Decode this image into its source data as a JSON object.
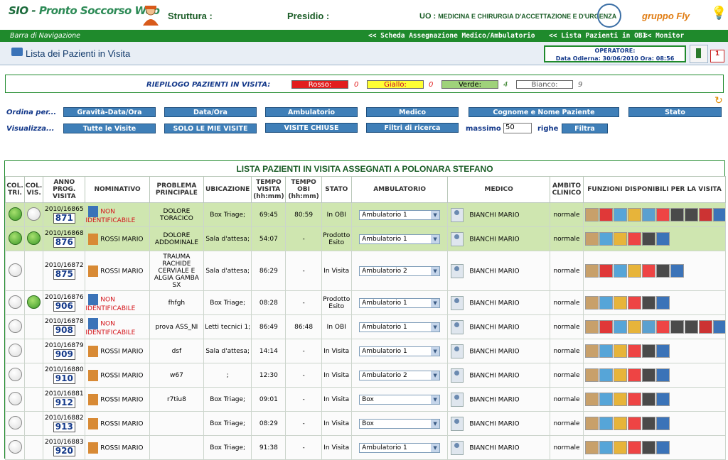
{
  "header": {
    "logo_text": "SIO - Pronto Soccorso Web",
    "struttura_label": "Struttura :",
    "presidio_label": "Presidio :",
    "uo_label": "UO :",
    "uo_value": "MEDICINA E CHIRURGIA D'ACCETTAZIONE E D'URGENZA",
    "brand": "gruppo Fly"
  },
  "nav": {
    "label": "Barra di Navigazione",
    "links": [
      "<< Scheda Assegnazione Medico/Ambulatorio",
      "<< Lista Pazienti in OBI",
      "<< Monitor Principale"
    ]
  },
  "page": {
    "title": "Lista dei Pazienti in Visita",
    "operator_label": "OPERATORE:",
    "date_line": "Data Odierna: 30/06/2010 Ora: 08:56"
  },
  "summary": {
    "label": "RIEPILOGO PAZIENTI IN VISITA:",
    "rosso": {
      "label": "Rosso:",
      "count": "0",
      "color": "#e21d1d"
    },
    "giallo": {
      "label": "Giallo:",
      "count": "0",
      "color": "#ffff33"
    },
    "verde": {
      "label": "Verde:",
      "count": "4",
      "color": "#9fd27a"
    },
    "bianco": {
      "label": "Bianco:",
      "count": "9",
      "color": "#ffffff"
    }
  },
  "controls": {
    "ordina_label": "Ordina per...",
    "visualizza_label": "Visualizza...",
    "sort_buttons": [
      "Gravità-Data/Ora",
      "Data/Ora",
      "Ambulatorio",
      "Medico",
      "Cognome e Nome Paziente",
      "Stato"
    ],
    "view_buttons": [
      "Tutte le Visite",
      "SOLO LE MIE VISITE",
      "VISITE CHIUSE",
      "Filtri di ricerca"
    ],
    "massimo_label": "massimo",
    "massimo_value": "50",
    "righe_label": "righe",
    "filtra_label": "Filtra"
  },
  "list": {
    "title": "LISTA PAZIENTI IN VISITA ASSEGNATI A POLONARA STEFANO",
    "columns": [
      "COL. TRI.",
      "COL. VIS.",
      "ANNO PROG. VISITA",
      "NOMINATIVO",
      "PROBLEMA PRINCIPALE",
      "UBICAZIONE",
      "TEMPO VISITA (hh:mm)",
      "TEMPO OBI (hh:mm)",
      "STATO",
      "AMBULATORIO",
      "MEDICO",
      "AMBITO CLINICO",
      "FUNZIONI DISPONIBILI PER LA VISITA"
    ],
    "rows": [
      {
        "tri": "green",
        "vis": "white",
        "anno": "2010/16865",
        "prog": "871",
        "nome": "NON IDENTIFICABILE",
        "problema": "DOLORE TORACICO",
        "ubicazione": "Box Triage;",
        "tempo": "69:45",
        "obi": "80:59",
        "stato": "In OBI",
        "ambulatorio": "Ambulatorio 1",
        "medico": "BIANCHI MARIO",
        "ambito": "normale",
        "row": "green"
      },
      {
        "tri": "green",
        "vis": "green",
        "anno": "2010/16868",
        "prog": "876",
        "nome": "ROSSI MARIO",
        "problema": "DOLORE ADDOMINALE",
        "ubicazione": "Sala d'attesa;",
        "tempo": "54:07",
        "obi": "-",
        "stato": "Prodotto Esito",
        "ambulatorio": "Ambulatorio 1",
        "medico": "BIANCHI MARIO",
        "ambito": "normale",
        "row": "green"
      },
      {
        "tri": "white",
        "vis": "none",
        "anno": "2010/16872",
        "prog": "875",
        "nome": "ROSSI MARIO",
        "problema": "TRAUMA RACHIDE CERVIALE E ALGIA GAMBA SX",
        "ubicazione": "Sala d'attesa;",
        "tempo": "86:29",
        "obi": "-",
        "stato": "In Visita",
        "ambulatorio": "Ambulatorio 2",
        "medico": "BIANCHI MARIO",
        "ambito": "normale",
        "row": "white"
      },
      {
        "tri": "white",
        "vis": "green",
        "anno": "2010/16876",
        "prog": "906",
        "nome": "NON IDENTIFICABILE",
        "problema": "fhfgh",
        "ubicazione": "Box Triage;",
        "tempo": "08:28",
        "obi": "-",
        "stato": "Prodotto Esito",
        "ambulatorio": "Ambulatorio 1",
        "medico": "BIANCHI MARIO",
        "ambito": "normale",
        "row": "white"
      },
      {
        "tri": "white",
        "vis": "none",
        "anno": "2010/16878",
        "prog": "908",
        "nome": "NON IDENTIFICABILE",
        "problema": "prova ASS_NI",
        "ubicazione": "Letti tecnici 1;",
        "tempo": "86:49",
        "obi": "86:48",
        "stato": "In OBI",
        "ambulatorio": "Ambulatorio 1",
        "medico": "BIANCHI MARIO",
        "ambito": "normale",
        "row": "white"
      },
      {
        "tri": "white",
        "vis": "none",
        "anno": "2010/16879",
        "prog": "909",
        "nome": "ROSSI MARIO",
        "problema": "dsf",
        "ubicazione": "Sala d'attesa;",
        "tempo": "14:14",
        "obi": "-",
        "stato": "In Visita",
        "ambulatorio": "Ambulatorio 1",
        "medico": "BIANCHI MARIO",
        "ambito": "normale",
        "row": "white"
      },
      {
        "tri": "white",
        "vis": "none",
        "anno": "2010/16880",
        "prog": "910",
        "nome": "ROSSI MARIO",
        "problema": "w67",
        "ubicazione": ";",
        "tempo": "12:30",
        "obi": "-",
        "stato": "In Visita",
        "ambulatorio": "Ambulatorio 2",
        "medico": "BIANCHI MARIO",
        "ambito": "normale",
        "row": "white"
      },
      {
        "tri": "white",
        "vis": "none",
        "anno": "2010/16881",
        "prog": "912",
        "nome": "ROSSI MARIO",
        "problema": "r7tiu8",
        "ubicazione": "Box Triage;",
        "tempo": "09:01",
        "obi": "-",
        "stato": "In Visita",
        "ambulatorio": "Box",
        "medico": "BIANCHI MARIO",
        "ambito": "normale",
        "row": "white"
      },
      {
        "tri": "white",
        "vis": "none",
        "anno": "2010/16882",
        "prog": "913",
        "nome": "ROSSI MARIO",
        "problema": "",
        "ubicazione": "Box Triage;",
        "tempo": "08:29",
        "obi": "-",
        "stato": "In Visita",
        "ambulatorio": "Box",
        "medico": "BIANCHI MARIO",
        "ambito": "normale",
        "row": "white"
      },
      {
        "tri": "white",
        "vis": "none",
        "anno": "2010/16883",
        "prog": "920",
        "nome": "ROSSI MARIO",
        "problema": "",
        "ubicazione": "Box Triage;",
        "tempo": "91:38",
        "obi": "-",
        "stato": "In Visita",
        "ambulatorio": "Ambulatorio 1",
        "medico": "BIANCHI MARIO",
        "ambito": "normale",
        "row": "white"
      }
    ]
  }
}
